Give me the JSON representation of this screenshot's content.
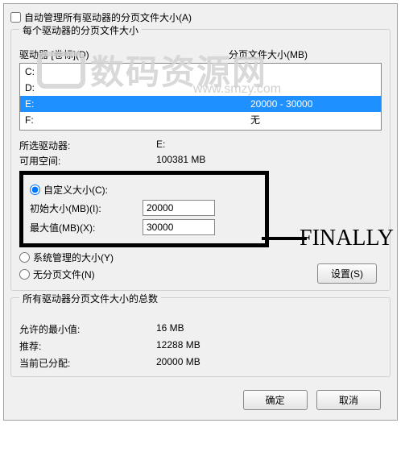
{
  "checkbox_auto": "自动管理所有驱动器的分页文件大小(A)",
  "group_each": "每个驱动器的分页文件大小",
  "col_drive": "驱动器 [卷标](D)",
  "col_pf": "分页文件大小(MB)",
  "drives": [
    {
      "letter": "C:",
      "value": ""
    },
    {
      "letter": "D:",
      "value": ""
    },
    {
      "letter": "E:",
      "value": "20000 - 30000",
      "selected": true
    },
    {
      "letter": "F:",
      "value": "无"
    }
  ],
  "sel_drive_label": "所选驱动器:",
  "sel_drive_value": "E:",
  "avail_label": "可用空间:",
  "avail_value": "100381 MB",
  "custom_radio": "自定义大小(C):",
  "init_label": "初始大小(MB)(I):",
  "init_value": "20000",
  "max_label": "最大值(MB)(X):",
  "max_value": "30000",
  "sys_radio": "系统管理的大小(Y)",
  "none_radio": "无分页文件(N)",
  "set_btn": "设置(S)",
  "totals_group": "所有驱动器分页文件大小的总数",
  "min_label": "允许的最小值:",
  "min_value": "16 MB",
  "rec_label": "推荐:",
  "rec_value": "12288 MB",
  "cur_label": "当前已分配:",
  "cur_value": "20000 MB",
  "ok_btn": "确定",
  "cancel_btn": "取消",
  "annotation": "FINALLY",
  "watermark_text": "数码资源网",
  "watermark_url": "www.smzy.com"
}
